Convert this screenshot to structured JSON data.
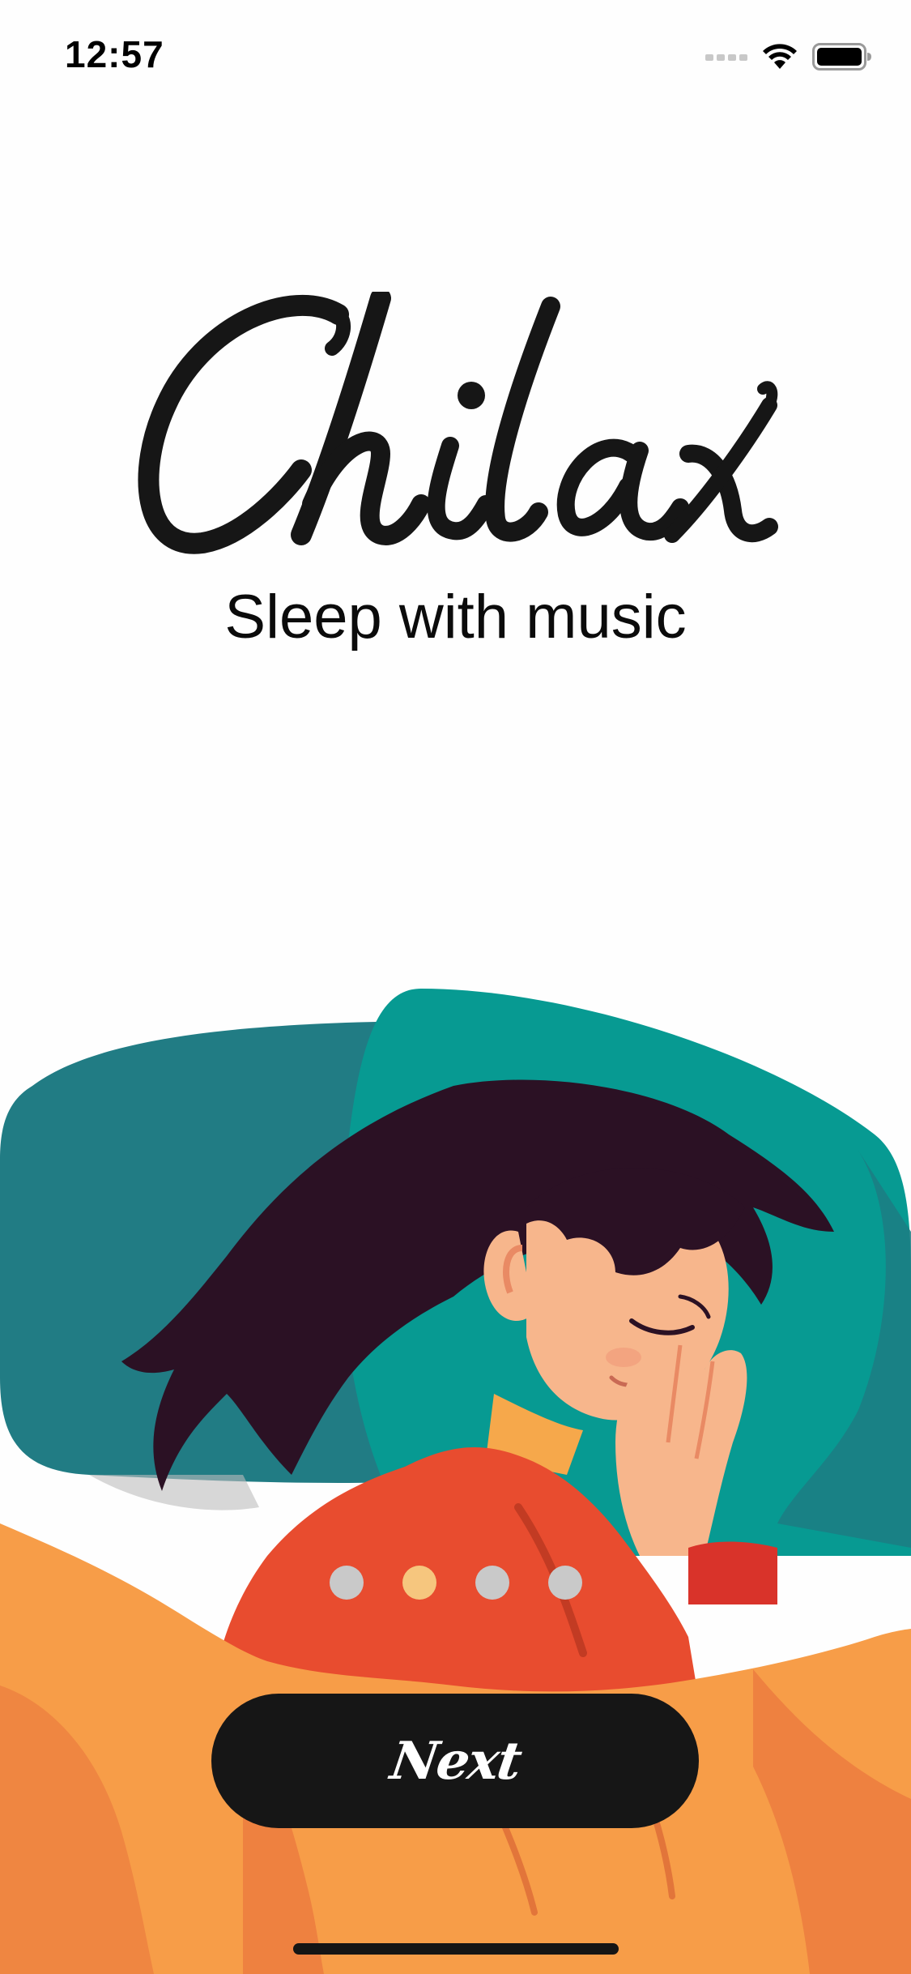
{
  "status_bar": {
    "time": "12:57",
    "icons": [
      "cellular-signal-icon",
      "wifi-icon",
      "battery-icon"
    ]
  },
  "app": {
    "logo_text": "Chilax",
    "tagline": "Sleep with music"
  },
  "onboarding": {
    "page_count": 4,
    "active_page": 2
  },
  "next_button": {
    "label": "Next"
  },
  "colors": {
    "background": "#fefefe",
    "button": "#161616",
    "dot_active": "#f6c67e",
    "dot_inactive": "#c9c9c9",
    "pillow": "#1f7f86",
    "pillow_light": "#06998f",
    "blanket": "#f8a04b",
    "pajama": "#e84c2f",
    "hair": "#2b1124",
    "skin": "#f7b68c"
  }
}
